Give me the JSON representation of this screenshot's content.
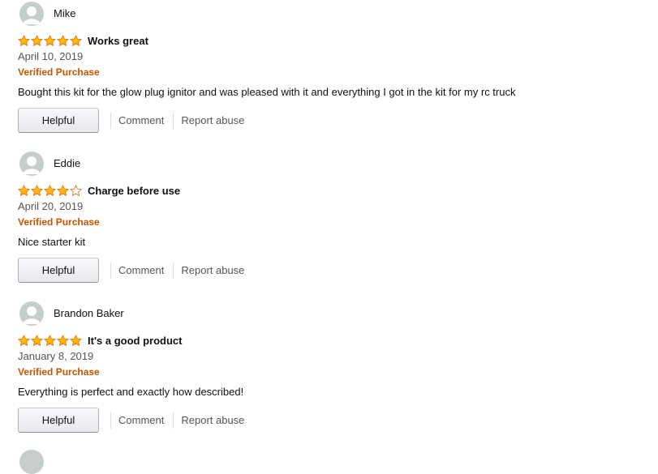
{
  "colors": {
    "star": "#ffa41c",
    "star_empty": "#de7921",
    "verified": "#c45500",
    "avatar_bg": "#c7cccc"
  },
  "reviews": [
    {
      "reviewer": "Mike",
      "rating": 5,
      "title": "Works great",
      "date": "April 10, 2019",
      "verified": "Verified Purchase",
      "body": "Bought this kit for the glow plug ignitor and was pleased with it and everything I got in the kit for my rc truck",
      "helpful_label": "Helpful",
      "comment_label": "Comment",
      "report_label": "Report abuse"
    },
    {
      "reviewer": "Eddie",
      "rating": 4,
      "title": "Charge before use",
      "date": "April 20, 2019",
      "verified": "Verified Purchase",
      "body": "Nice starter kit",
      "helpful_label": "Helpful",
      "comment_label": "Comment",
      "report_label": "Report abuse"
    },
    {
      "reviewer": "Brandon Baker",
      "rating": 5,
      "title": "It's a good product",
      "date": "January 8, 2019",
      "verified": "Verified Purchase",
      "body": "Everything is perfect and exactly how described!",
      "helpful_label": "Helpful",
      "comment_label": "Comment",
      "report_label": "Report abuse"
    }
  ],
  "icons": {
    "avatar": "user-silhouette-icon",
    "star_full": "star-filled-icon",
    "star_empty": "star-outline-icon"
  }
}
